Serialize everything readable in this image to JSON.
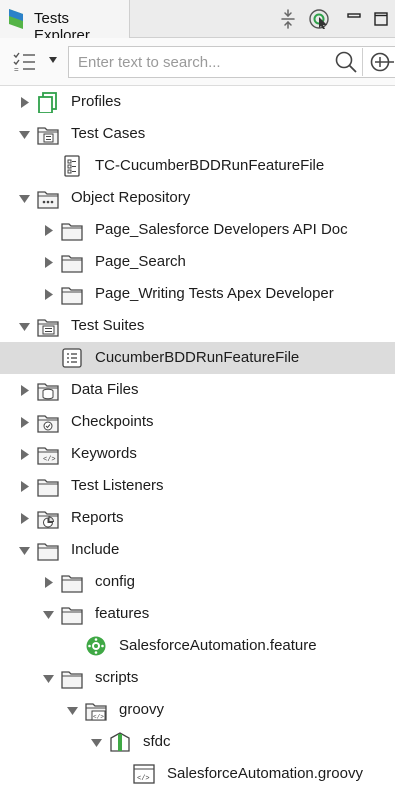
{
  "panel": {
    "title": "Tests Explorer",
    "icon": "katalon-logo-icon",
    "toolbar": [
      "collapse-all-icon",
      "link-editor-icon",
      "minimize-icon",
      "maximize-icon"
    ]
  },
  "search": {
    "placeholder": "Enter text to search...",
    "value": ""
  },
  "colors": {
    "folder_fill": "#f4f4f4",
    "folder_stroke": "#4a4a4a",
    "selection": "#dcdcdc",
    "toggle": "#6c6c6c",
    "feature_green": "#3fa845",
    "logo_green": "#55b447",
    "logo_blue": "#2c82c9"
  },
  "tree": [
    {
      "label": "Profiles",
      "level": 0,
      "toggle": "collapsed",
      "icon": "profiles-icon"
    },
    {
      "label": "Test Cases",
      "level": 0,
      "toggle": "expanded",
      "icon": "test-cases-folder-icon"
    },
    {
      "label": "TC-CucumberBDDRunFeatureFile",
      "level": 1,
      "toggle": "none",
      "icon": "test-case-icon"
    },
    {
      "label": "Object Repository",
      "level": 0,
      "toggle": "expanded",
      "icon": "object-repository-icon"
    },
    {
      "label": "Page_Salesforce Developers  API Doc",
      "level": 1,
      "toggle": "collapsed",
      "icon": "folder-icon"
    },
    {
      "label": "Page_Search",
      "level": 1,
      "toggle": "collapsed",
      "icon": "folder-icon"
    },
    {
      "label": "Page_Writing Tests  Apex Developer",
      "level": 1,
      "toggle": "collapsed",
      "icon": "folder-icon"
    },
    {
      "label": "Test Suites",
      "level": 0,
      "toggle": "expanded",
      "icon": "test-suites-folder-icon"
    },
    {
      "label": "CucumberBDDRunFeatureFile",
      "level": 1,
      "toggle": "none",
      "icon": "test-suite-icon",
      "selected": true
    },
    {
      "label": "Data Files",
      "level": 0,
      "toggle": "collapsed",
      "icon": "data-files-icon"
    },
    {
      "label": "Checkpoints",
      "level": 0,
      "toggle": "collapsed",
      "icon": "checkpoints-icon"
    },
    {
      "label": "Keywords",
      "level": 0,
      "toggle": "collapsed",
      "icon": "keywords-icon"
    },
    {
      "label": "Test Listeners",
      "level": 0,
      "toggle": "collapsed",
      "icon": "folder-icon"
    },
    {
      "label": "Reports",
      "level": 0,
      "toggle": "collapsed",
      "icon": "reports-icon"
    },
    {
      "label": "Include",
      "level": 0,
      "toggle": "expanded",
      "icon": "folder-icon"
    },
    {
      "label": "config",
      "level": 1,
      "toggle": "collapsed",
      "icon": "folder-icon"
    },
    {
      "label": "features",
      "level": 1,
      "toggle": "expanded",
      "icon": "folder-icon"
    },
    {
      "label": "SalesforceAutomation.feature",
      "level": 2,
      "toggle": "none",
      "icon": "cucumber-feature-icon"
    },
    {
      "label": "scripts",
      "level": 1,
      "toggle": "expanded",
      "icon": "folder-icon"
    },
    {
      "label": "groovy",
      "level": 2,
      "toggle": "expanded",
      "icon": "source-folder-icon"
    },
    {
      "label": "sfdc",
      "level": 3,
      "toggle": "expanded",
      "icon": "package-icon"
    },
    {
      "label": "SalesforceAutomation.groovy",
      "level": 4,
      "toggle": "none",
      "icon": "groovy-file-icon"
    }
  ]
}
